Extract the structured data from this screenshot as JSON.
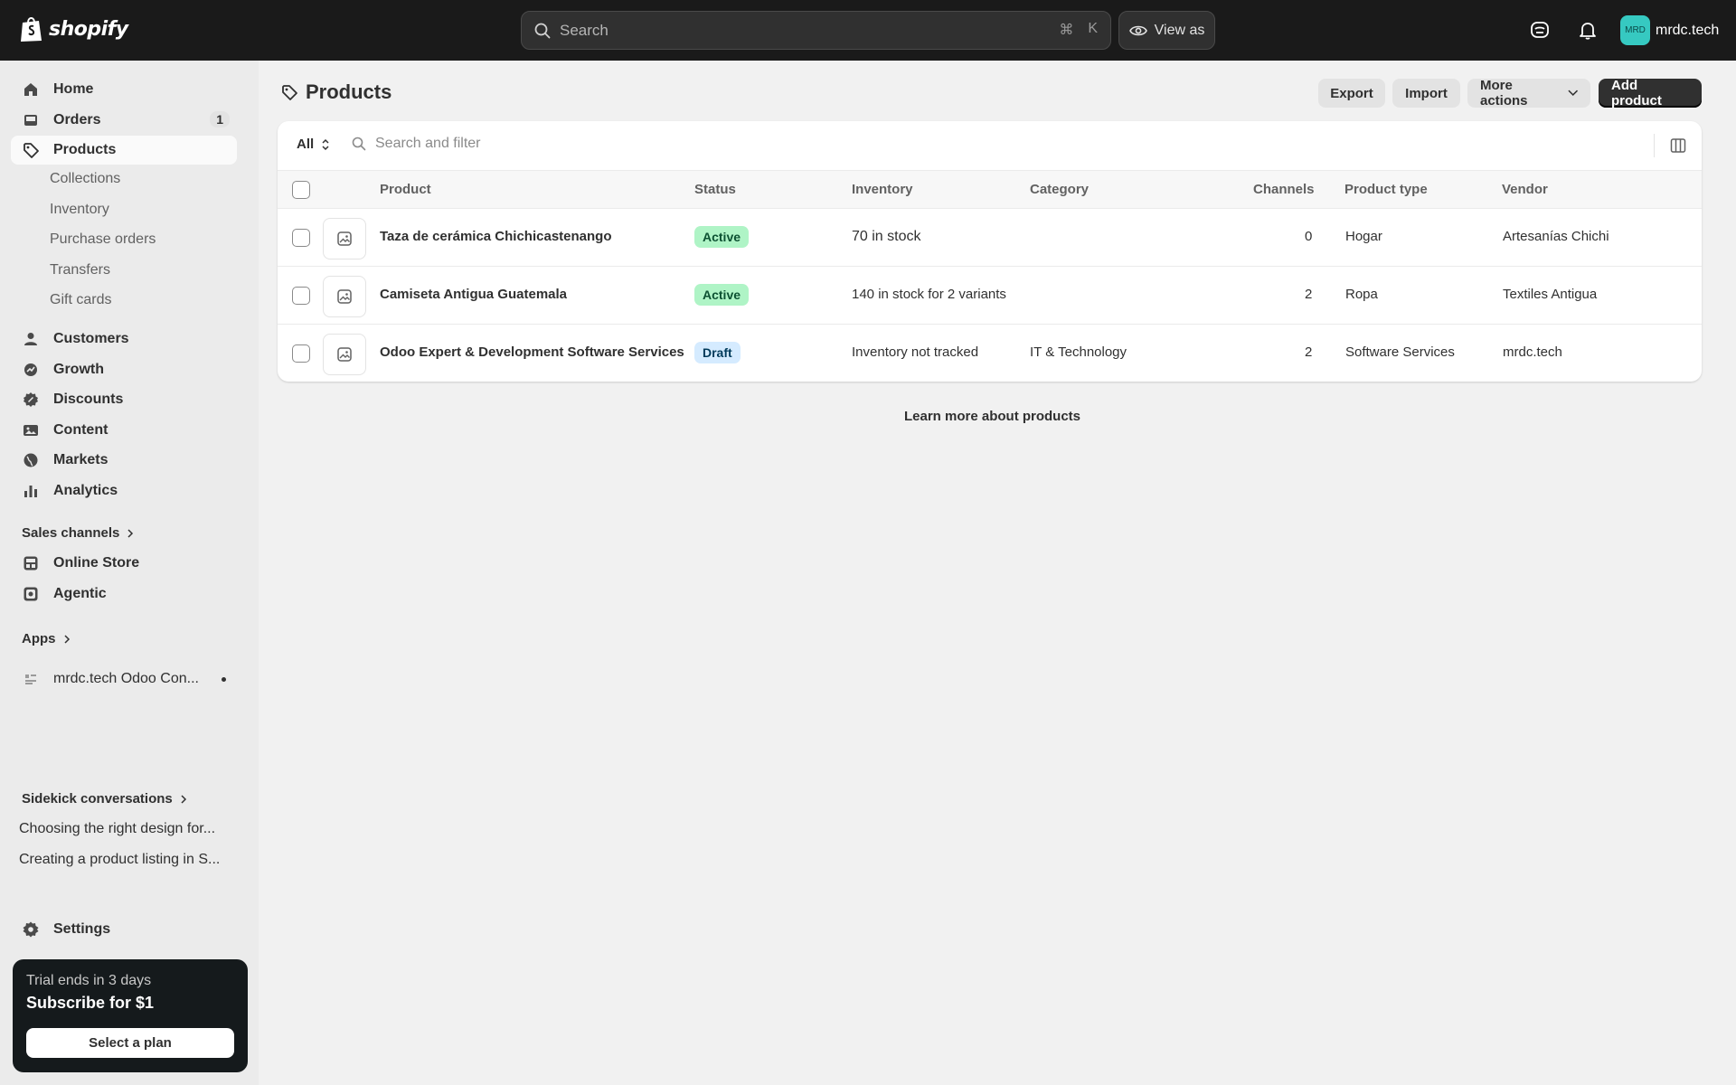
{
  "topbar": {
    "logo_text": "shopify",
    "search_placeholder": "Search",
    "shortcut_cmd": "⌘",
    "shortcut_key": "K",
    "view_as_label": "View as",
    "avatar_initials": "MRD",
    "store_name": "mrdc.tech"
  },
  "sidebar": {
    "nav": [
      {
        "label": "Home",
        "icon": "home-icon"
      },
      {
        "label": "Orders",
        "icon": "inbox-icon",
        "badge": "1"
      },
      {
        "label": "Products",
        "icon": "tag-icon"
      }
    ],
    "product_sub": [
      "Collections",
      "Inventory",
      "Purchase orders",
      "Transfers",
      "Gift cards"
    ],
    "nav2": [
      {
        "label": "Customers",
        "icon": "person-icon"
      },
      {
        "label": "Growth",
        "icon": "growth-icon"
      },
      {
        "label": "Discounts",
        "icon": "discount-icon"
      },
      {
        "label": "Content",
        "icon": "content-icon"
      },
      {
        "label": "Markets",
        "icon": "globe-icon"
      },
      {
        "label": "Analytics",
        "icon": "chart-bar-icon"
      }
    ],
    "sales_channels_title": "Sales channels",
    "channels": [
      {
        "label": "Online Store",
        "icon": "store-icon"
      },
      {
        "label": "Agentic",
        "icon": "agentic-icon"
      }
    ],
    "apps_title": "Apps",
    "app_item": "mrdc.tech Odoo Con...",
    "sidekick_title": "Sidekick conversations",
    "conversations": [
      "Choosing the right design for...",
      "Creating a product listing in S..."
    ],
    "settings_label": "Settings",
    "trial": {
      "subtitle": "Trial ends in 3 days",
      "title": "Subscribe for $1",
      "button": "Select a plan"
    }
  },
  "main": {
    "title": "Products",
    "buttons": {
      "export": "Export",
      "import": "Import",
      "more_actions": "More actions",
      "add_product": "Add product"
    },
    "filter": {
      "tab": "All",
      "search_placeholder": "Search and filter"
    },
    "columns": [
      "Product",
      "Status",
      "Inventory",
      "Category",
      "Channels",
      "Product type",
      "Vendor"
    ],
    "rows": [
      {
        "product": "Taza de cerámica Chichicastenango",
        "status": "Active",
        "inventory": "70 in stock",
        "category": "",
        "channels": "0",
        "type": "Hogar",
        "vendor": "Artesanías Chichi"
      },
      {
        "product": "Camiseta Antigua Guatemala",
        "status": "Active",
        "inventory": "140 in stock for 2 variants",
        "category": "",
        "channels": "2",
        "type": "Ropa",
        "vendor": "Textiles Antigua"
      },
      {
        "product": "Odoo Expert & Development Software Services",
        "status": "Draft",
        "inventory": "Inventory not tracked",
        "category": "IT & Technology",
        "channels": "2",
        "type": "Software Services",
        "vendor": "mrdc.tech"
      }
    ],
    "learn_more": "Learn more about products"
  },
  "colors": {
    "topbar": "#1a1a1a",
    "active_badge": "#aff4c6",
    "draft_badge": "#d5ebff",
    "primary_button": "#303030",
    "avatar": "#36c9c1"
  }
}
